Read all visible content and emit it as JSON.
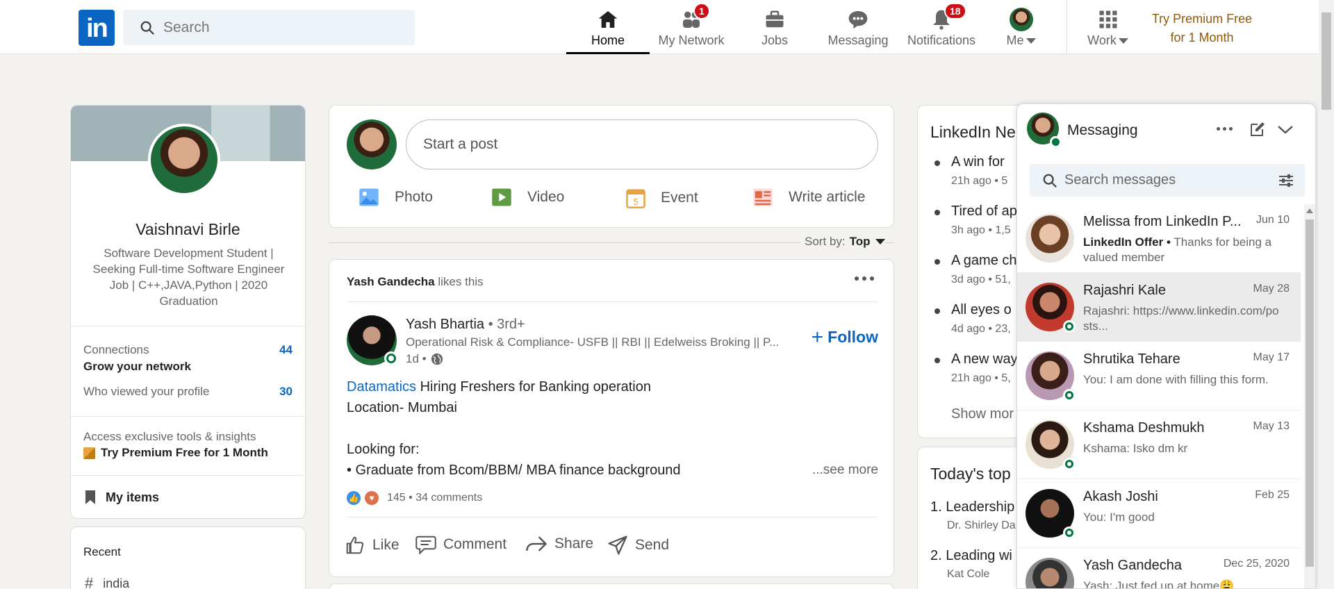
{
  "nav": {
    "logo": "in",
    "search_placeholder": "Search",
    "items": [
      {
        "label": "Home",
        "badge": ""
      },
      {
        "label": "My Network",
        "badge": "1"
      },
      {
        "label": "Jobs",
        "badge": ""
      },
      {
        "label": "Messaging",
        "badge": ""
      },
      {
        "label": "Notifications",
        "badge": "18"
      },
      {
        "label": "Me",
        "badge": ""
      },
      {
        "label": "Work",
        "badge": ""
      }
    ],
    "premium_line1": "Try Premium Free",
    "premium_line2": "for 1 Month"
  },
  "profile": {
    "name": "Vaishnavi Birle",
    "headline": "Software Development Student | Seeking Full-time Software Engineer Job | C++,JAVA,Python | 2020 Graduation",
    "connections_label": "Connections",
    "connections_count": "44",
    "grow_network": "Grow your network",
    "viewers_label": "Who viewed your profile",
    "viewers_count": "30",
    "premium_text": "Access exclusive tools & insights",
    "premium_cta": "Try Premium Free for 1 Month",
    "my_items": "My items"
  },
  "recent": {
    "title": "Recent",
    "items": [
      "india"
    ]
  },
  "share_box": {
    "placeholder": "Start a post",
    "photo": "Photo",
    "video": "Video",
    "event": "Event",
    "article": "Write article"
  },
  "sort": {
    "label": "Sort by:",
    "value": "Top"
  },
  "post": {
    "context_name": "Yash Gandecha",
    "context_action": "likes this",
    "author": "Yash Bhartia",
    "degree": "• 3rd+",
    "author_headline": "Operational Risk & Compliance- USFB || RBI || Edelweiss Broking || P...",
    "time": "1d •",
    "follow": "Follow",
    "mention": "Datamatics",
    "line1": " Hiring Freshers for Banking operation",
    "line2": "Location- Mumbai",
    "line3": "Looking for:",
    "line4": "• Graduate from Bcom/BBM/ MBA finance background",
    "see_more": "...see more",
    "reactions": "145 • 34 comments",
    "like": "Like",
    "comment": "Comment",
    "share": "Share",
    "send": "Send"
  },
  "news": {
    "title": "LinkedIn Ne",
    "items": [
      {
        "title": "A win for",
        "meta": "21h ago • 5"
      },
      {
        "title": "Tired of ap",
        "meta": "3h ago • 1,5"
      },
      {
        "title": "A game ch",
        "meta": "3d ago • 51,"
      },
      {
        "title": "All eyes o",
        "meta": "4d ago • 23,"
      },
      {
        "title": "A new way",
        "meta": "21h ago • 5,"
      }
    ],
    "show_more": "Show mor"
  },
  "courses": {
    "title": "Today's top",
    "items": [
      {
        "title": "1. Leadership",
        "author": "Dr. Shirley Da"
      },
      {
        "title": "2. Leading wi",
        "author": "Kat Cole"
      }
    ]
  },
  "messaging": {
    "title": "Messaging",
    "search_placeholder": "Search messages",
    "conversations": [
      {
        "name": "Melissa from LinkedIn P...",
        "date": "Jun 10",
        "preview_bold": "LinkedIn Offer •",
        "preview": " Thanks for being a valued member",
        "online": false
      },
      {
        "name": "Rajashri Kale",
        "date": "May 28",
        "preview_bold": "",
        "preview": "Rajashri: https://www.linkedin.com/posts...",
        "online": true
      },
      {
        "name": "Shrutika Tehare",
        "date": "May 17",
        "preview_bold": "",
        "preview": "You: I am done with filling this form.",
        "online": true
      },
      {
        "name": "Kshama Deshmukh",
        "date": "May 13",
        "preview_bold": "",
        "preview": "Kshama: Isko dm kr",
        "online": true
      },
      {
        "name": "Akash Joshi",
        "date": "Feb 25",
        "preview_bold": "",
        "preview": "You: I'm good",
        "online": true
      },
      {
        "name": "Yash Gandecha",
        "date": "Dec 25, 2020",
        "preview_bold": "",
        "preview": "Yash: Just fed up at home😩",
        "online": false
      }
    ]
  }
}
